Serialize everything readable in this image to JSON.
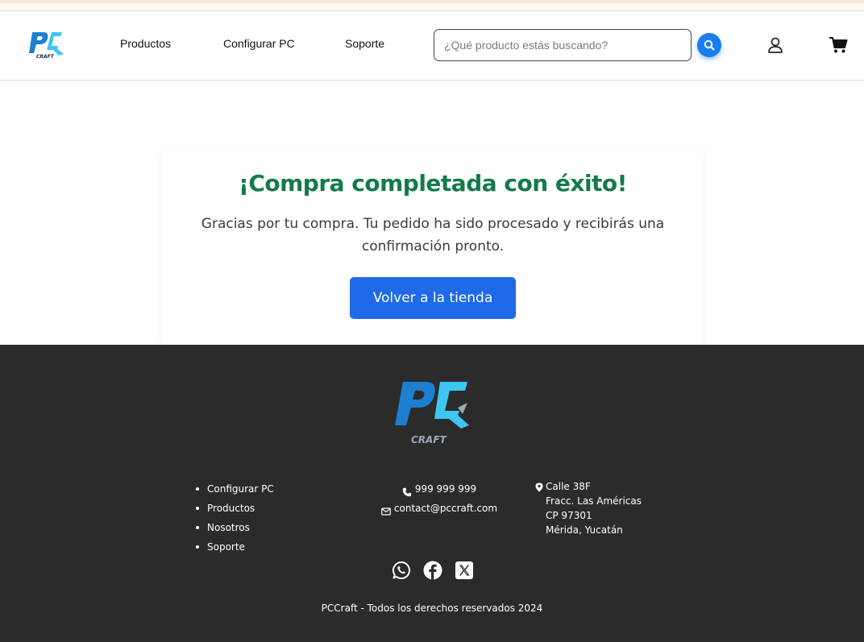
{
  "header": {
    "nav": {
      "productos": "Productos",
      "configurar": "Configurar PC",
      "soporte": "Soporte"
    },
    "search": {
      "placeholder": "¿Qué producto estás buscando?",
      "value": ""
    },
    "icons": {
      "search": "search-icon",
      "user": "user-icon",
      "cart": "cart-icon"
    }
  },
  "confirmation": {
    "title": "¡Compra completada con éxito!",
    "message": "Gracias por tu compra. Tu pedido ha sido procesado y recibirás una confirmación pronto.",
    "button": "Volver a la tienda"
  },
  "footer": {
    "links": [
      "Configurar PC",
      "Productos",
      "Nosotros",
      "Soporte"
    ],
    "phone": "999 999 999",
    "email": "contact@pccraft.com",
    "address": [
      "Calle 38F",
      "Fracc. Las Américas",
      "CP 97301",
      "Mérida, Yucatán"
    ],
    "socials": [
      "whatsapp-icon",
      "facebook-icon",
      "x-icon"
    ],
    "copyright": "PCCraft - Todos los derechos reservados 2024"
  },
  "brand": {
    "logo_text": "CRAFT"
  },
  "colors": {
    "accent": "#1a7cf0",
    "button": "#1f6ae9",
    "success": "#137a4c",
    "footer_bg": "#2b2b2b",
    "logo_blue": "#1d7fd0",
    "logo_cyan": "#3dc7f2"
  }
}
